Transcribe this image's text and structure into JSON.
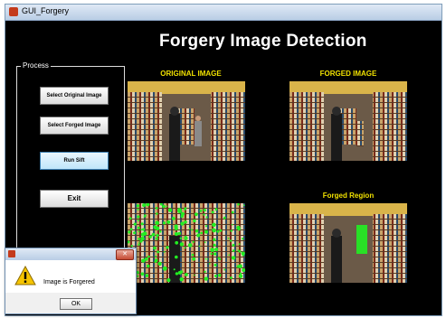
{
  "window": {
    "title": "GUI_Forgery"
  },
  "header": {
    "title": "Forgery Image Detection"
  },
  "process_panel": {
    "label": "Process",
    "buttons": {
      "select_original": "Select Original Image",
      "select_forged": "Select Forged Image",
      "run_sift": "Run Sift",
      "exit": "Exit"
    }
  },
  "images": {
    "original_label": "ORIGINAL IMAGE",
    "forged_label": "FORGED IMAGE",
    "forged_region_label": "Forged Region"
  },
  "dialog": {
    "message": "Image is Forgered",
    "ok_label": "OK",
    "icon": "warning-icon"
  },
  "colors": {
    "label": "#f0e000",
    "background": "#000000",
    "keypoints": "#22ee22"
  }
}
